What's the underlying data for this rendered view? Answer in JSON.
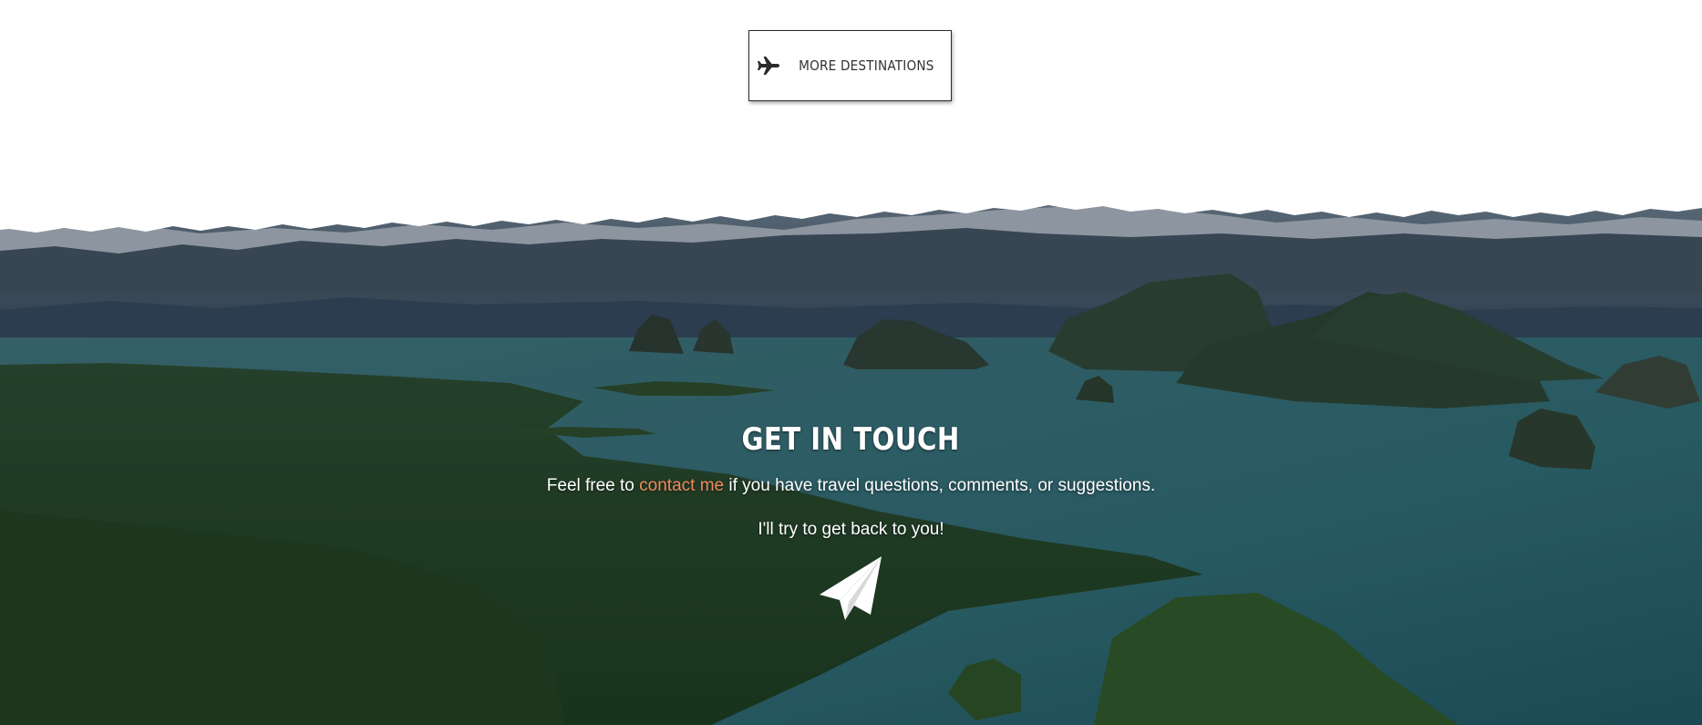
{
  "more_destinations": {
    "label": "MORE DESTINATIONS",
    "icon": "airplane-icon"
  },
  "contact": {
    "title": "GET IN TOUCH",
    "line1_before": "Feel free to",
    "link_text": "contact me",
    "line1_after": "if you have travel questions, comments, or suggestions.",
    "line2": "I'll try to get back to you!",
    "icon": "paper-plane-icon"
  },
  "colors": {
    "link": "#f08a5d",
    "heading": "#ffffff",
    "button_border": "#2b2b2b"
  }
}
